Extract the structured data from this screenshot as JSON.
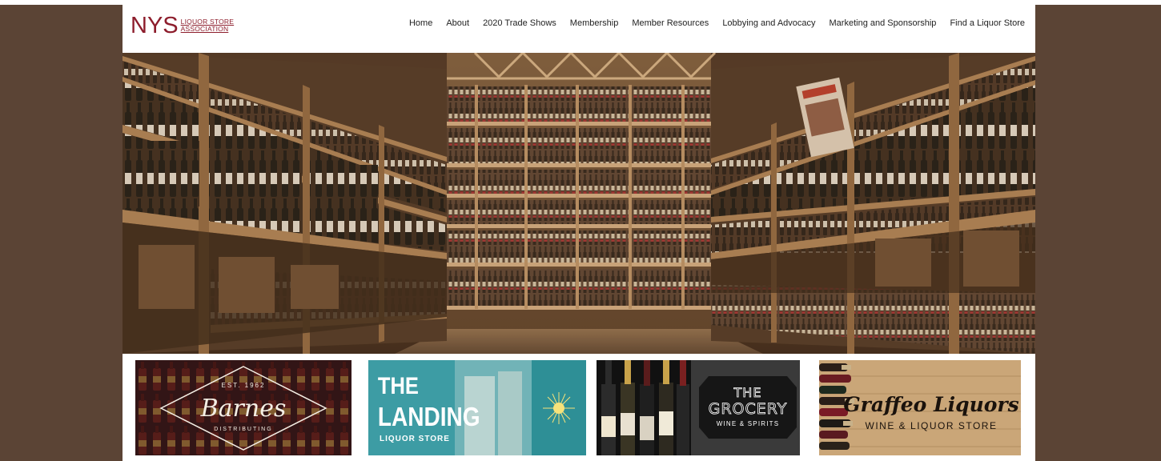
{
  "logo": {
    "main": "NYS",
    "line1": "LIQUOR STORE",
    "line2": "ASSOCIATION"
  },
  "nav": {
    "items": [
      {
        "label": "Home"
      },
      {
        "label": "About"
      },
      {
        "label": "2020 Trade Shows"
      },
      {
        "label": "Membership"
      },
      {
        "label": "Member Resources"
      },
      {
        "label": "Lobbying and Advocacy"
      },
      {
        "label": "Marketing and Sponsorship"
      },
      {
        "label": "Find a Liquor Store"
      }
    ]
  },
  "sponsors": {
    "barnes": {
      "est": "EST. 1962",
      "name": "Barnes",
      "sub": "DISTRIBUTING"
    },
    "landing": {
      "line1": "THE",
      "line2": "LANDING",
      "line3": "LIQUOR STORE"
    },
    "grocery": {
      "line1": "THE",
      "line2": "GROCERY",
      "line3": "WINE & SPIRITS"
    },
    "graffeo": {
      "name": "Graffeo Liquors",
      "sub": "WINE & LIQUOR STORE"
    }
  },
  "colors": {
    "page_bg": "#5b4435",
    "brand": "#8d1d2c",
    "landing_teal": "#3d9ca4",
    "grocery_bg": "#3a3a3a"
  }
}
